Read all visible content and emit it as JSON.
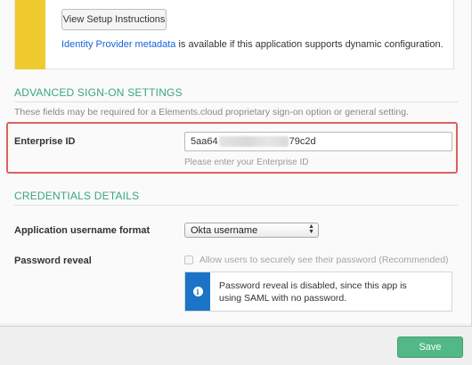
{
  "setup": {
    "button_label": "View Setup Instructions",
    "metadata_link": "Identity Provider metadata",
    "metadata_suffix": " is available if this application supports dynamic configuration."
  },
  "advanced_signon": {
    "title": "ADVANCED SIGN-ON SETTINGS",
    "description": "These fields may be required for a Elements.cloud proprietary sign-on option or general setting.",
    "enterprise_id": {
      "label": "Enterprise ID",
      "value_prefix": "5aa64",
      "value_suffix": "79c2d",
      "hint": "Please enter your Enterprise ID"
    }
  },
  "credentials": {
    "title": "CREDENTIALS DETAILS",
    "username_format": {
      "label": "Application username format",
      "selected": "Okta username"
    },
    "password_reveal": {
      "label": "Password reveal",
      "checkbox_label": "Allow users to securely see their password (Recommended)",
      "checked": false,
      "info_text": "Password reveal is disabled, since this app is using SAML with no password."
    }
  },
  "footer": {
    "save_label": "Save"
  },
  "colors": {
    "section_title": "#3aa67a",
    "setup_stripe": "#f0cb2f",
    "highlight": "#e06060",
    "info_stripe": "#1c74c6",
    "save_button": "#52b886",
    "link": "#1662dd"
  },
  "icons": {
    "info": "info-icon",
    "select_arrows": "up-down-arrows-icon"
  }
}
